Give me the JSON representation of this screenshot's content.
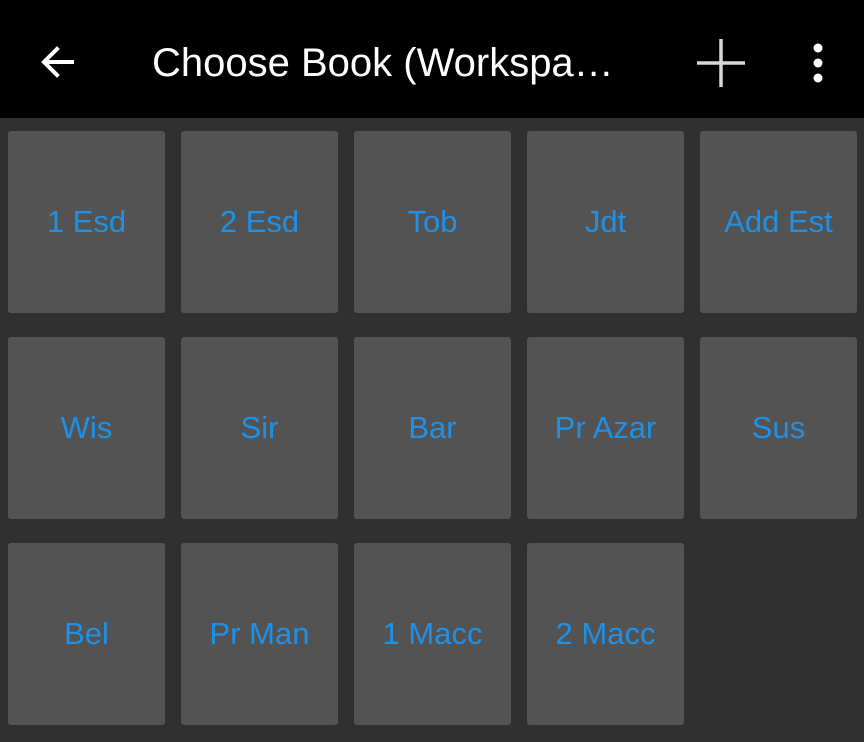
{
  "toolbar": {
    "title": "Choose Book (Workspa…",
    "back_icon": "arrow-left-icon",
    "add_icon": "plus-icon",
    "menu_icon": "more-vertical-icon",
    "background": "#000000"
  },
  "colors": {
    "background": "#303030",
    "tile": "#535353",
    "label": "#1e90e6"
  },
  "books": [
    {
      "label": "1 Esd"
    },
    {
      "label": "2 Esd"
    },
    {
      "label": "Tob"
    },
    {
      "label": "Jdt"
    },
    {
      "label": "Add Est"
    },
    {
      "label": "Wis"
    },
    {
      "label": "Sir"
    },
    {
      "label": "Bar"
    },
    {
      "label": "Pr Azar"
    },
    {
      "label": "Sus"
    },
    {
      "label": "Bel"
    },
    {
      "label": "Pr Man"
    },
    {
      "label": "1 Macc"
    },
    {
      "label": "2 Macc"
    }
  ]
}
